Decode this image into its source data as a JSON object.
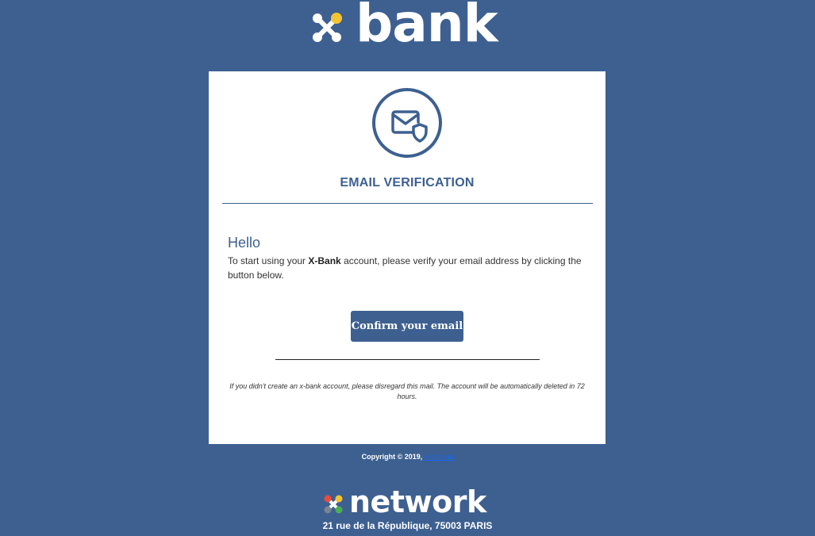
{
  "brand": {
    "logo_text": "bank"
  },
  "email": {
    "title": "EMAIL VERIFICATION",
    "greeting": "Hello",
    "message_before": "To start using your ",
    "message_brand": "X-Bank",
    "message_after": "  account, please verify your email address by clicking the button below.",
    "confirm_label": "Confirm your email",
    "disclaimer": "If you didn't create an x-bank account, please disregard this mail. The account will be automatically deleted in 72 hours."
  },
  "footer": {
    "copyright": "Copyright © 2019, ",
    "link_text": "x-bank.io",
    "network_text": "network",
    "address": "21 rue de la République, 75003 PARIS"
  },
  "colors": {
    "background": "#3d6090",
    "accent": "#3d6090",
    "logo_dot": "#f6c433",
    "link": "#1565ff"
  },
  "icons": {
    "brand": "xbank-logo-icon",
    "badge": "email-shield-icon",
    "network": "network-logo-icon"
  }
}
